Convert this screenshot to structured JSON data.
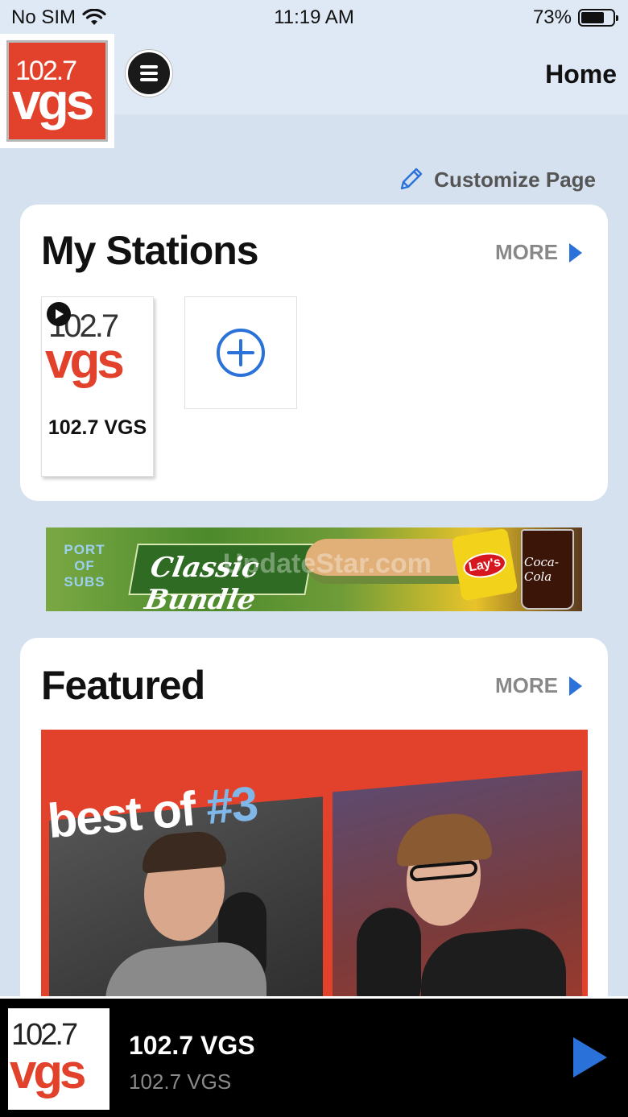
{
  "status_bar": {
    "carrier": "No SIM",
    "time": "11:19 AM",
    "battery_percent": "73%",
    "battery_level": 0.73
  },
  "header": {
    "logo_freq": "102.7",
    "logo_call": "vgs",
    "title": "Home"
  },
  "customize": {
    "label": "Customize Page"
  },
  "my_stations": {
    "title": "My Stations",
    "more_label": "MORE",
    "stations": [
      {
        "freq": "102.7",
        "call": "vgs",
        "name": "102.7 VGS"
      }
    ]
  },
  "ad": {
    "brand_lines": [
      "PORT",
      "OF",
      "SUBS"
    ],
    "headline": "Classic Bundle",
    "chip_brand": "Lay's",
    "drink_brand": "Coca-Cola",
    "watermark": "UpdateStar.com"
  },
  "featured": {
    "title": "Featured",
    "more_label": "MORE",
    "image_text_prefix": "best of ",
    "image_text_number": "#3"
  },
  "player": {
    "logo_freq": "102.7",
    "logo_call": "vgs",
    "title": "102.7 VGS",
    "subtitle": "102.7 VGS"
  },
  "colors": {
    "brand_red": "#e2412b",
    "accent_blue": "#2a72d9",
    "background": "#d6e1ef"
  }
}
